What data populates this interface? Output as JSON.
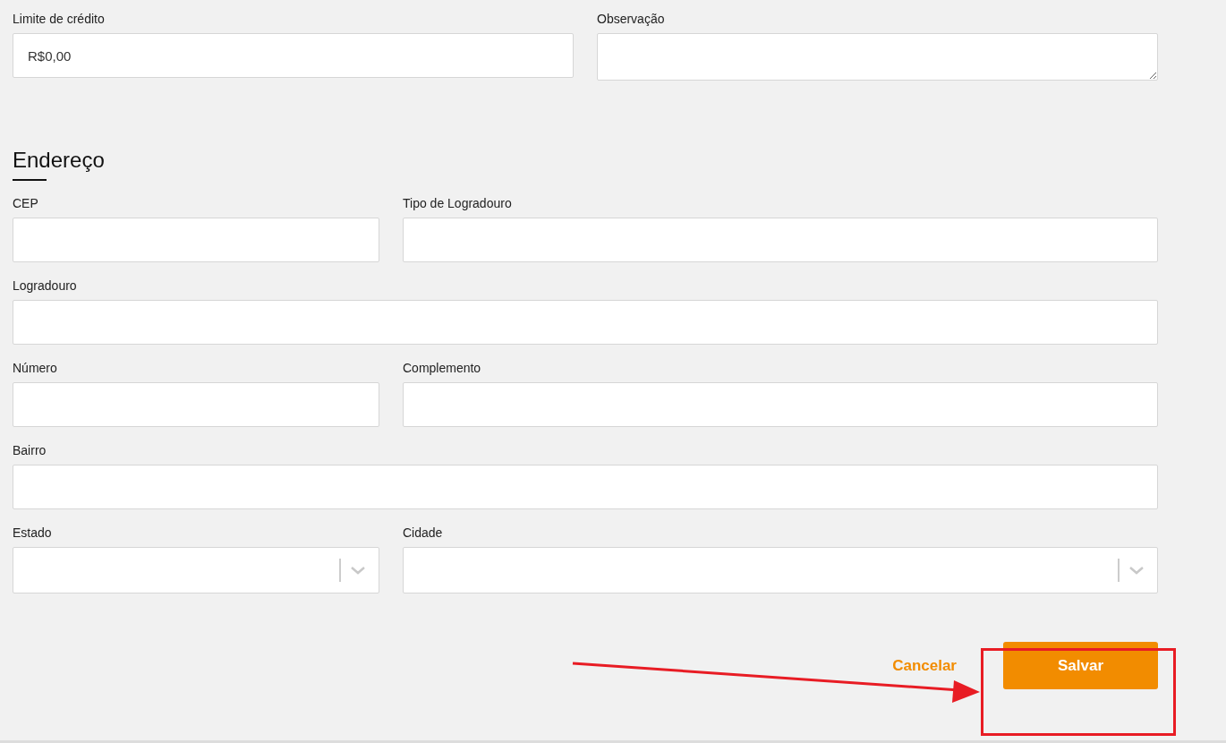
{
  "top_fields": [
    {
      "label": "Limite de crédito",
      "kind": "text",
      "value": "R$0,00"
    },
    {
      "label": "Observação",
      "kind": "textarea"
    }
  ],
  "address": {
    "title": "Endereço",
    "rows": [
      [
        {
          "label": "CEP",
          "kind": "text"
        },
        {
          "label": "Tipo de Logradouro",
          "kind": "text"
        }
      ],
      [
        {
          "label": "Logradouro",
          "kind": "text"
        }
      ],
      [
        {
          "label": "Número",
          "kind": "text"
        },
        {
          "label": "Complemento",
          "kind": "text"
        }
      ],
      [
        {
          "label": "Bairro",
          "kind": "text"
        }
      ],
      [
        {
          "label": "Estado",
          "kind": "select"
        },
        {
          "label": "Cidade",
          "kind": "select"
        }
      ]
    ]
  },
  "buttons": [
    {
      "label": "Cancelar",
      "kind": "link"
    },
    {
      "label": "Salvar",
      "kind": "primary"
    }
  ]
}
